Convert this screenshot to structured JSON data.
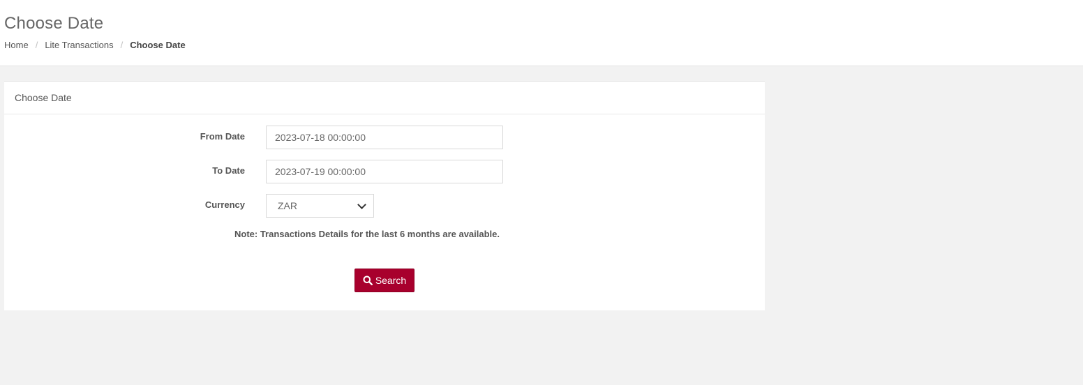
{
  "header": {
    "title": "Choose Date",
    "breadcrumb": {
      "home": "Home",
      "section": "Lite Transactions",
      "current": "Choose Date"
    }
  },
  "panel": {
    "title": "Choose Date",
    "from_date": {
      "label": "From Date",
      "value": "2023-07-18 00:00:00"
    },
    "to_date": {
      "label": "To Date",
      "value": "2023-07-19 00:00:00"
    },
    "currency": {
      "label": "Currency",
      "selected": "ZAR"
    },
    "note": "Note: Transactions Details for the last 6 months are available.",
    "search_button": {
      "label": "Search",
      "icon": "search-icon",
      "color": "#a8002d"
    }
  }
}
